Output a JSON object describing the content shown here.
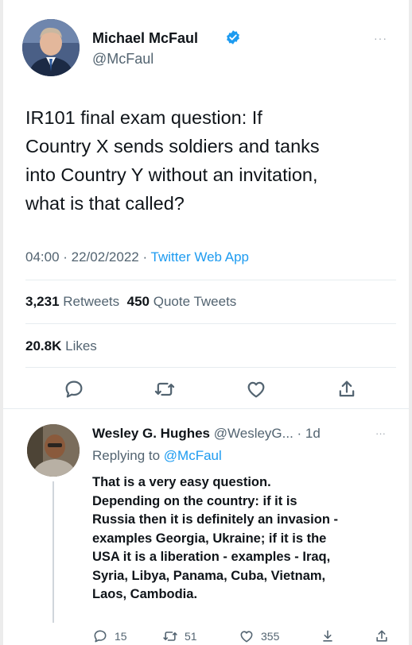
{
  "main_tweet": {
    "author_name": "Michael McFaul",
    "handle": "@McFaul",
    "more": "···",
    "text_lines": [
      "IR101 final exam question: If",
      "Country X sends soldiers and tanks",
      "into Country Y without an invitation,",
      "what is that called?"
    ],
    "time": "04:00 · 22/02/2022 · ",
    "source": "Twitter Web App",
    "retweets_count": "3,231",
    "retweets_label": "Retweets",
    "quotes_count": "450",
    "quotes_label": "Quote Tweets",
    "likes_count": "20.8K",
    "likes_label": "Likes",
    "actions": [
      "reply-icon",
      "retweet-icon",
      "like-icon",
      "share-icon"
    ]
  },
  "reply": {
    "author_name": "Wesley G. Hughes",
    "handle_time": " @WesleyG... · 1d",
    "more": "···",
    "replying_prefix": "Replying to ",
    "replying_mention": "@McFaul",
    "text_lines": [
      "That is a very easy question.",
      "Depending on the country: if it is",
      "Russia then it is definitely an invasion -",
      "examples Georgia, Ukraine; if it is the",
      "USA it is a liberation - examples - Iraq,",
      "Syria, Libya, Panama, Cuba, Vietnam,",
      "Laos, Cambodia."
    ],
    "reply_count": "15",
    "retweet_count": "51",
    "like_count": "355"
  },
  "colors": {
    "link": "#1d9bf0",
    "secondary_text": "#536471",
    "primary_text": "#0f1419"
  }
}
